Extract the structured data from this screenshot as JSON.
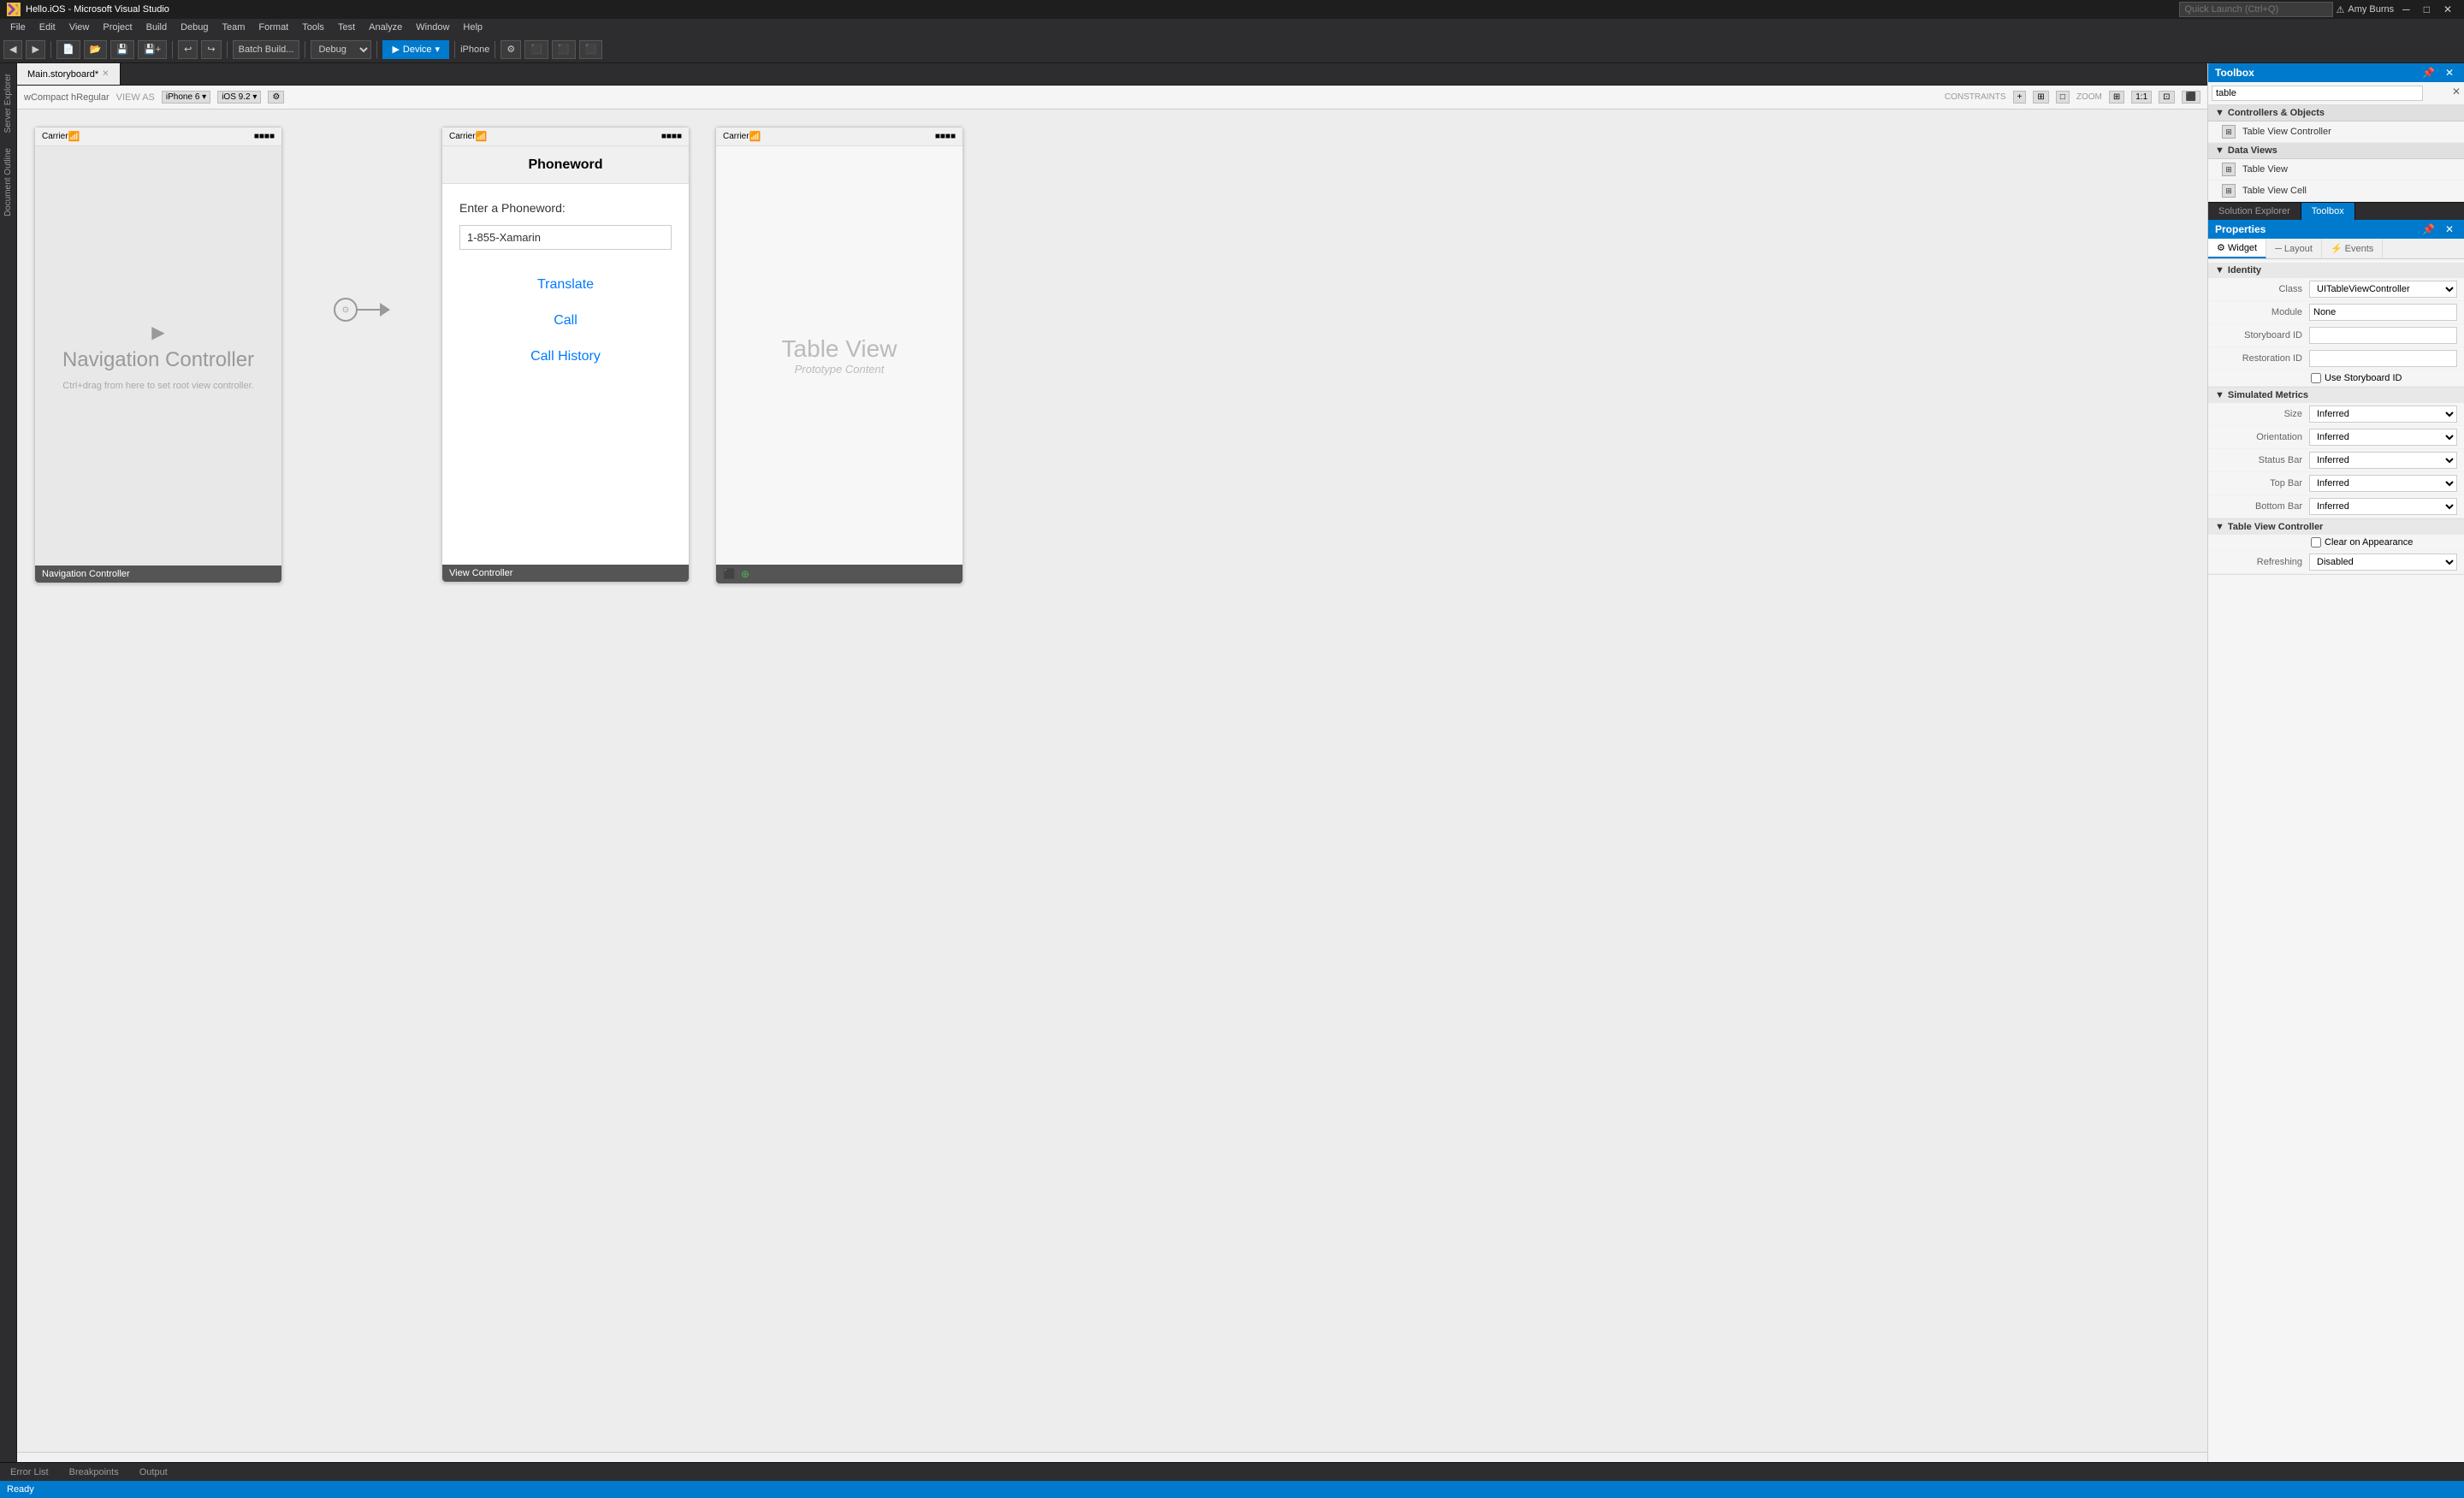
{
  "titleBar": {
    "title": "Hello.iOS - Microsoft Visual Studio",
    "icon": "VS",
    "searchPlaceholder": "Quick Launch (Ctrl+Q)",
    "userName": "Amy Burns",
    "minBtn": "─",
    "restoreBtn": "□",
    "closeBtn": "✕"
  },
  "menuBar": {
    "items": [
      "File",
      "Edit",
      "View",
      "Project",
      "Build",
      "Debug",
      "Team",
      "Format",
      "Tools",
      "Test",
      "Analyze",
      "Window",
      "Help"
    ]
  },
  "toolbar": {
    "batchBuild": "Batch Build...",
    "debug": "Debug",
    "device": "Device",
    "iphone": "iPhone",
    "runLabel": "▶ Device"
  },
  "canvasToolbar": {
    "filename": "Main.storyboard*",
    "viewAs": "VIEW AS:",
    "iphone6": "iPhone 6 ▾",
    "ios": "iOS 9.2 ▾",
    "constraints": "CONSTRAINTS",
    "zoom": "ZOOM"
  },
  "navigationController": {
    "carrier": "Carrier",
    "battery": "■■■■",
    "label": "Navigation Controller",
    "sublabel": "Ctrl+drag from here to set root view controller.",
    "footerLabel": "Navigation Controller"
  },
  "viewController": {
    "carrier": "Carrier",
    "battery": "■■■■",
    "title": "Phoneword",
    "enterLabel": "Enter a Phoneword:",
    "inputValue": "1-855-Xamarin",
    "translateBtn": "Translate",
    "callBtn": "Call",
    "callHistoryBtn": "Call History",
    "footerLabel": "View Controller"
  },
  "tableViewController": {
    "carrier": "Carrier",
    "battery": "■■■■",
    "tableViewLabel": "Table View",
    "tableViewSub": "Prototype Content",
    "footerLabel": ""
  },
  "toolbox": {
    "title": "Toolbox",
    "searchValue": "table",
    "sections": [
      {
        "name": "Controllers & Objects",
        "items": [
          {
            "label": "Table View Controller",
            "icon": "⊞"
          }
        ]
      },
      {
        "name": "Data Views",
        "items": [
          {
            "label": "Table View",
            "icon": "⊞"
          },
          {
            "label": "Table View Cell",
            "icon": "⊞"
          }
        ]
      }
    ]
  },
  "solutionTabs": [
    {
      "label": "Solution Explorer",
      "active": false
    },
    {
      "label": "Toolbox",
      "active": true
    }
  ],
  "properties": {
    "title": "Properties",
    "tabs": [
      {
        "label": "Widget",
        "icon": "⚙",
        "active": true
      },
      {
        "label": "Layout",
        "icon": "─"
      },
      {
        "label": "Events",
        "icon": "⚡"
      }
    ],
    "sections": [
      {
        "name": "Identity",
        "rows": [
          {
            "label": "Class",
            "type": "select",
            "value": "UITableViewController",
            "options": [
              "UITableViewController"
            ]
          },
          {
            "label": "Module",
            "type": "input",
            "value": "None"
          },
          {
            "label": "Storyboard ID",
            "type": "input",
            "value": ""
          },
          {
            "label": "Restoration ID",
            "type": "input",
            "value": ""
          }
        ],
        "checkboxes": [
          {
            "label": "Use Storyboard ID",
            "checked": false
          }
        ]
      },
      {
        "name": "Simulated Metrics",
        "rows": [
          {
            "label": "Size",
            "type": "select",
            "value": "Inferred"
          },
          {
            "label": "Orientation",
            "type": "select",
            "value": "Inferred"
          },
          {
            "label": "Status Bar",
            "type": "select",
            "value": "Inferred"
          },
          {
            "label": "Top Bar",
            "type": "select",
            "value": "Inferred"
          },
          {
            "label": "Bottom Bar",
            "type": "select",
            "value": "Inferred"
          }
        ]
      },
      {
        "name": "Table View Controller",
        "checkboxes": [
          {
            "label": "Clear on Appearance",
            "checked": false
          }
        ],
        "rows": [
          {
            "label": "Refreshing",
            "type": "select",
            "value": "Disabled"
          }
        ]
      }
    ]
  },
  "statusBar": {
    "status": "Ready"
  },
  "leftSidebar": {
    "items": [
      "Server Explorer",
      "Document Outline"
    ]
  }
}
